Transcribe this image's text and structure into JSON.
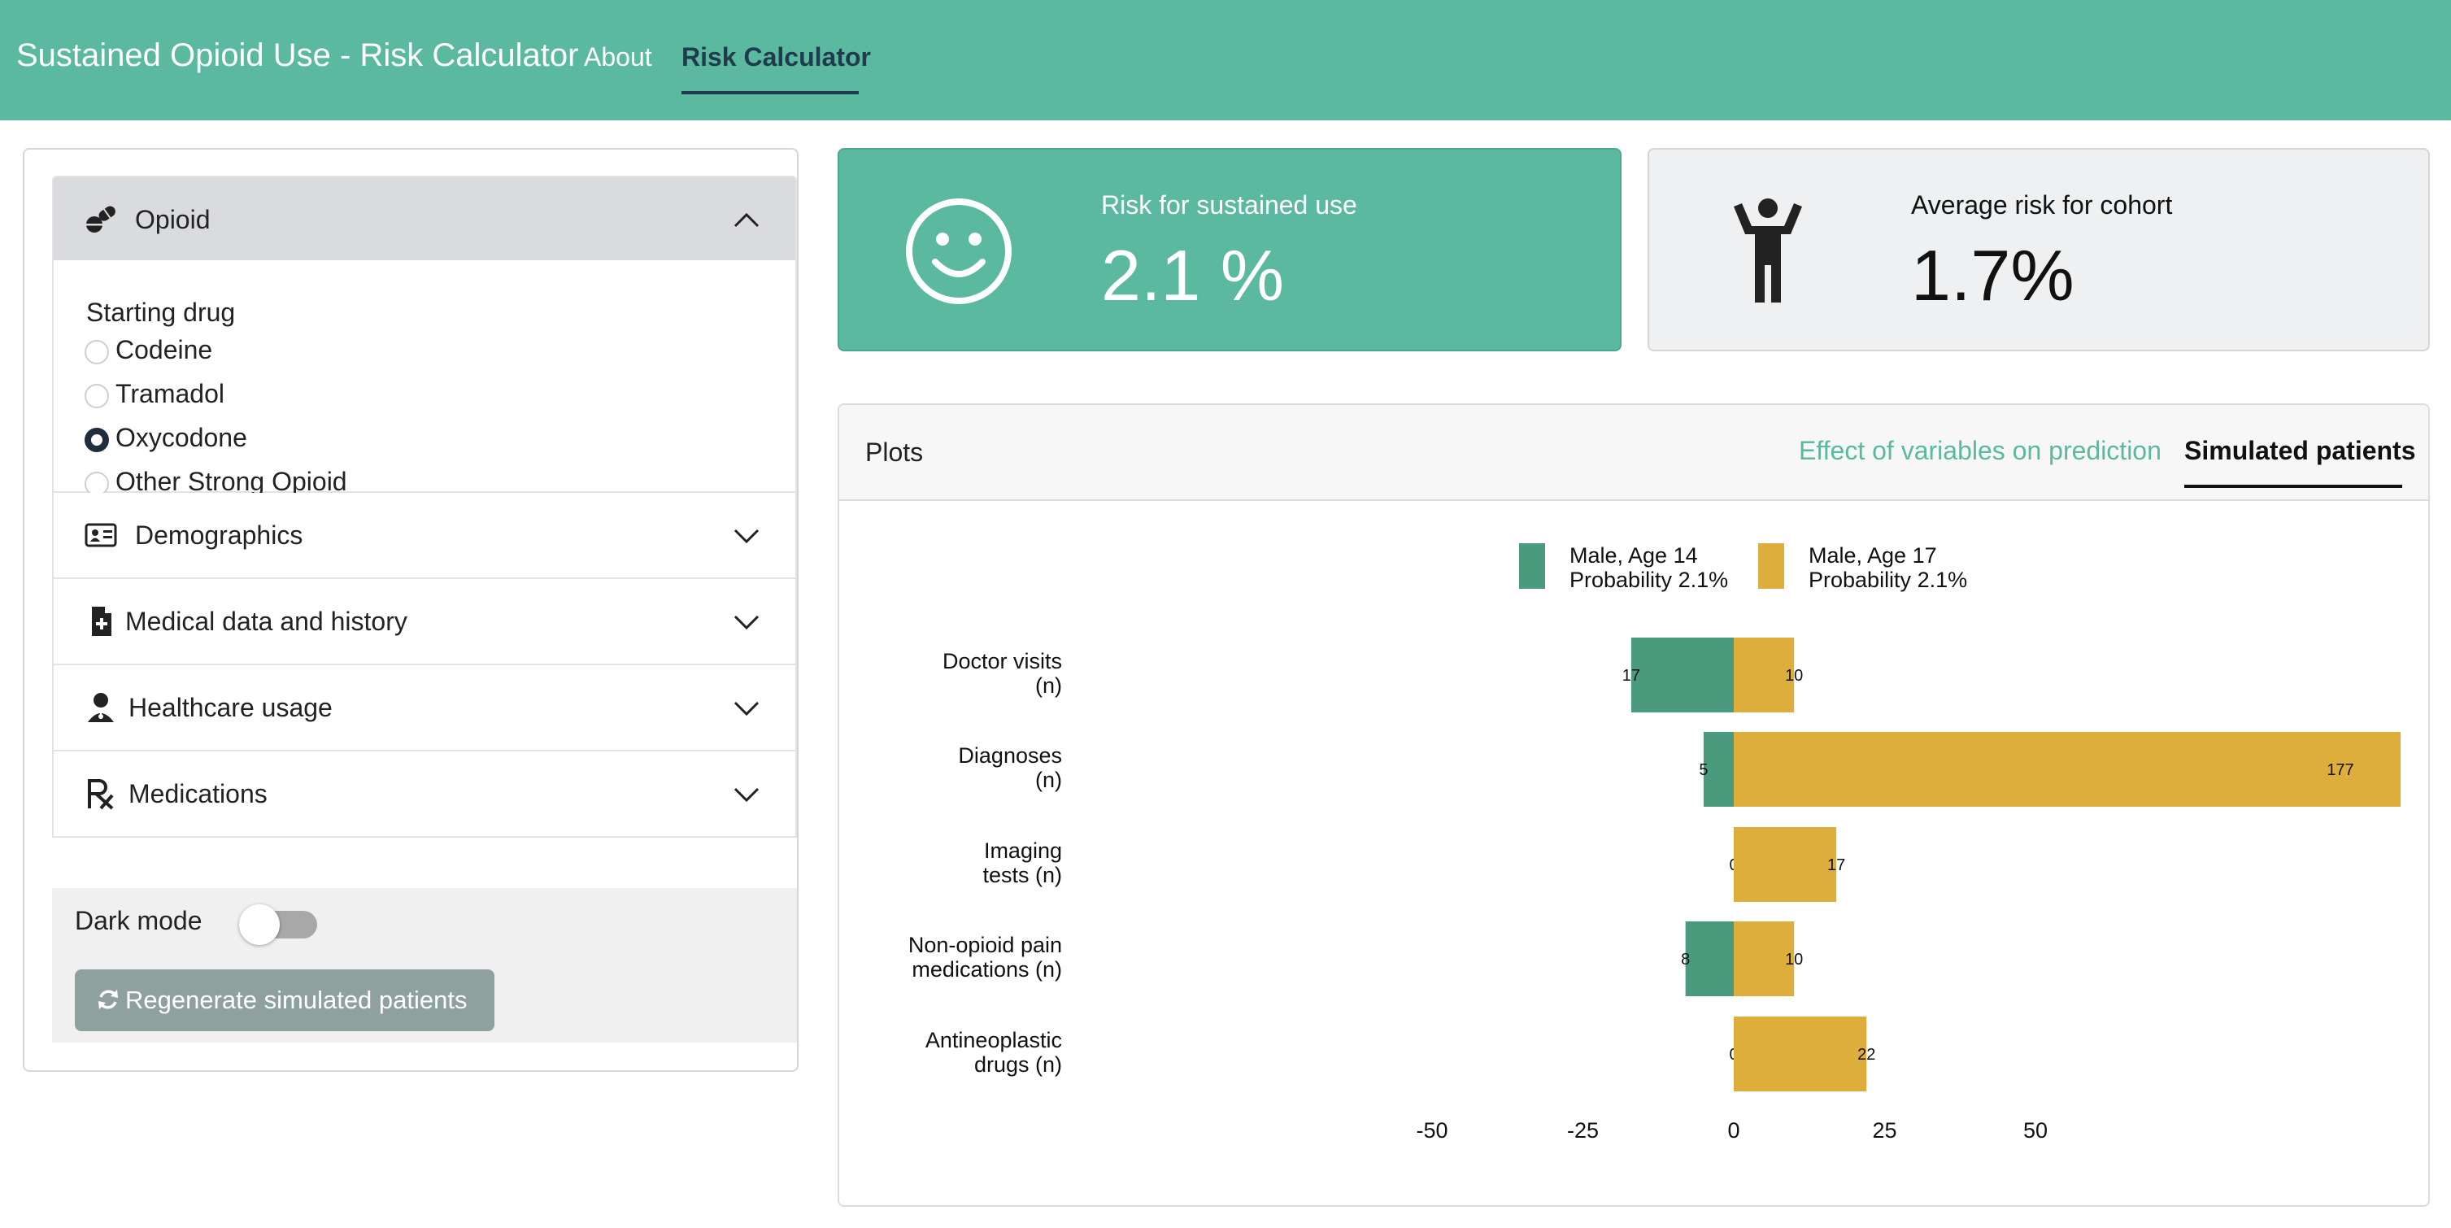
{
  "navbar": {
    "brand": "Sustained Opioid Use - Risk Calculator",
    "links": [
      {
        "label": "About"
      },
      {
        "label": "Risk Calculator"
      }
    ],
    "color": "#5ab99e"
  },
  "sidebar": {
    "opioid": {
      "title": "Opioid",
      "icon": "pills-icon",
      "field_label": "Starting drug",
      "options": [
        {
          "label": "Codeine",
          "checked": false
        },
        {
          "label": "Tramadol",
          "checked": false
        },
        {
          "label": "Oxycodone",
          "checked": true
        },
        {
          "label": "Other Strong Opioid",
          "checked": false
        }
      ]
    },
    "sections": [
      {
        "title": "Demographics",
        "icon": "id-card-icon"
      },
      {
        "title": "Medical data and history",
        "icon": "file-medical-icon"
      },
      {
        "title": "Healthcare usage",
        "icon": "user-doctor-icon"
      },
      {
        "title": "Medications",
        "icon": "prescription-icon"
      }
    ],
    "dark_mode_label": "Dark mode",
    "dark_mode_on": false,
    "regenerate_label": "Regenerate simulated patients"
  },
  "value_boxes": {
    "risk": {
      "title": "Risk for sustained use",
      "value": "2.1 %",
      "icon": "smiley-icon"
    },
    "cohort": {
      "title": "Average risk for cohort",
      "value": "1.7%",
      "icon": "person-icon"
    }
  },
  "plots": {
    "title": "Plots",
    "tabs": [
      {
        "label": "Effect of variables on prediction",
        "active": false
      },
      {
        "label": "Simulated patients",
        "active": true
      }
    ]
  },
  "chart_data": {
    "type": "bar",
    "orientation": "horizontal",
    "layout": "diverging",
    "categories": [
      [
        "Doctor visits",
        "(n)"
      ],
      [
        "Diagnoses",
        "(n)"
      ],
      [
        "Imaging",
        "tests (n)"
      ],
      [
        "Non-opioid pain",
        "medications (n)"
      ],
      [
        "Antineoplastic",
        "drugs (n)"
      ]
    ],
    "series": [
      {
        "name": [
          "Male, Age 14",
          "Probability 2.1%"
        ],
        "values": [
          17,
          5,
          0,
          8,
          0
        ],
        "color": "#4a9b7e"
      },
      {
        "name": [
          "Male, Age 17",
          "Probability 2.1%"
        ],
        "values": [
          10,
          177,
          17,
          10,
          22
        ],
        "color": "#ddae3c"
      }
    ],
    "x_ticks": [
      "-50",
      "-25",
      "0",
      "25",
      "50"
    ],
    "xlim": [
      -55,
      55
    ],
    "legend_position": "top"
  }
}
